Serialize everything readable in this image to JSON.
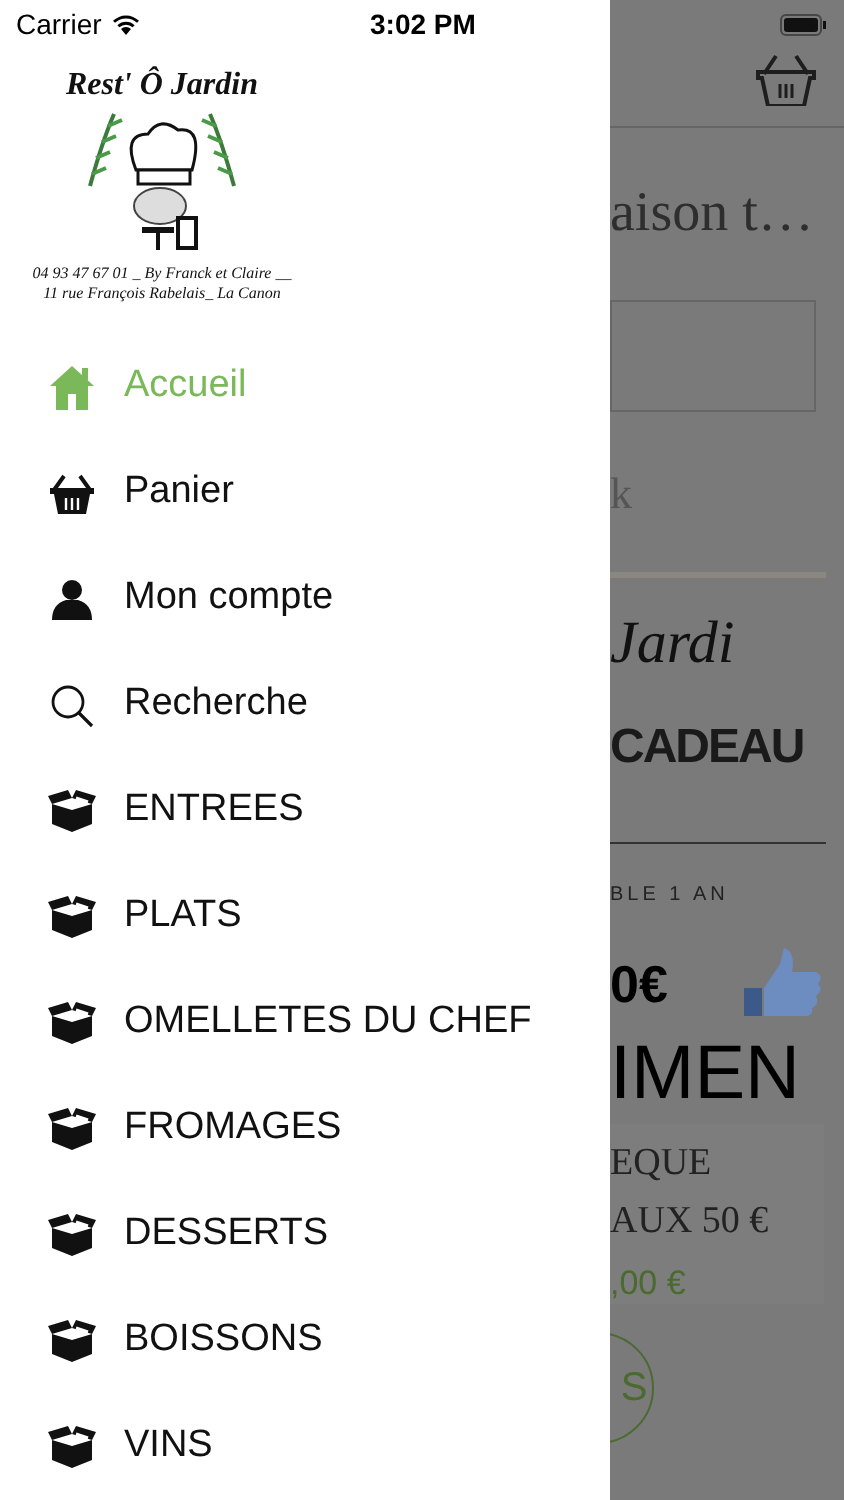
{
  "status_bar": {
    "carrier": "Carrier",
    "time": "3:02 PM"
  },
  "drawer": {
    "logo": {
      "title": "Rest' Ô Jardin",
      "ring_text": "04 93 47 67 01 _ By Franck et Claire __ 11 rue François Rabelais_ La Canon"
    },
    "items": [
      {
        "label": "Accueil",
        "kind": "home",
        "selected": true
      },
      {
        "label": "Panier",
        "kind": "basket",
        "selected": false
      },
      {
        "label": "Mon compte",
        "kind": "person",
        "selected": false
      },
      {
        "label": "Recherche",
        "kind": "search",
        "selected": false
      },
      {
        "label": "ENTREES",
        "kind": "box",
        "selected": false
      },
      {
        "label": "PLATS",
        "kind": "box",
        "selected": false
      },
      {
        "label": "OMELLETES DU CHEF",
        "kind": "box",
        "selected": false
      },
      {
        "label": "FROMAGES",
        "kind": "box",
        "selected": false
      },
      {
        "label": "DESSERTS",
        "kind": "box",
        "selected": false
      },
      {
        "label": "BOISSONS",
        "kind": "box",
        "selected": false
      },
      {
        "label": "VINS",
        "kind": "box",
        "selected": false
      }
    ]
  },
  "background_page": {
    "title": "aison t…",
    "text_1": "k",
    "banner_script": "Jardi",
    "banner_heading": "CADEAU",
    "banner_small": "BLE 1 AN",
    "banner_price": "0€",
    "banner_word": "IMEN",
    "product_name": [
      "EQUE",
      "AUX 50 €"
    ],
    "product_price": ",00 €",
    "round_button": "S"
  }
}
